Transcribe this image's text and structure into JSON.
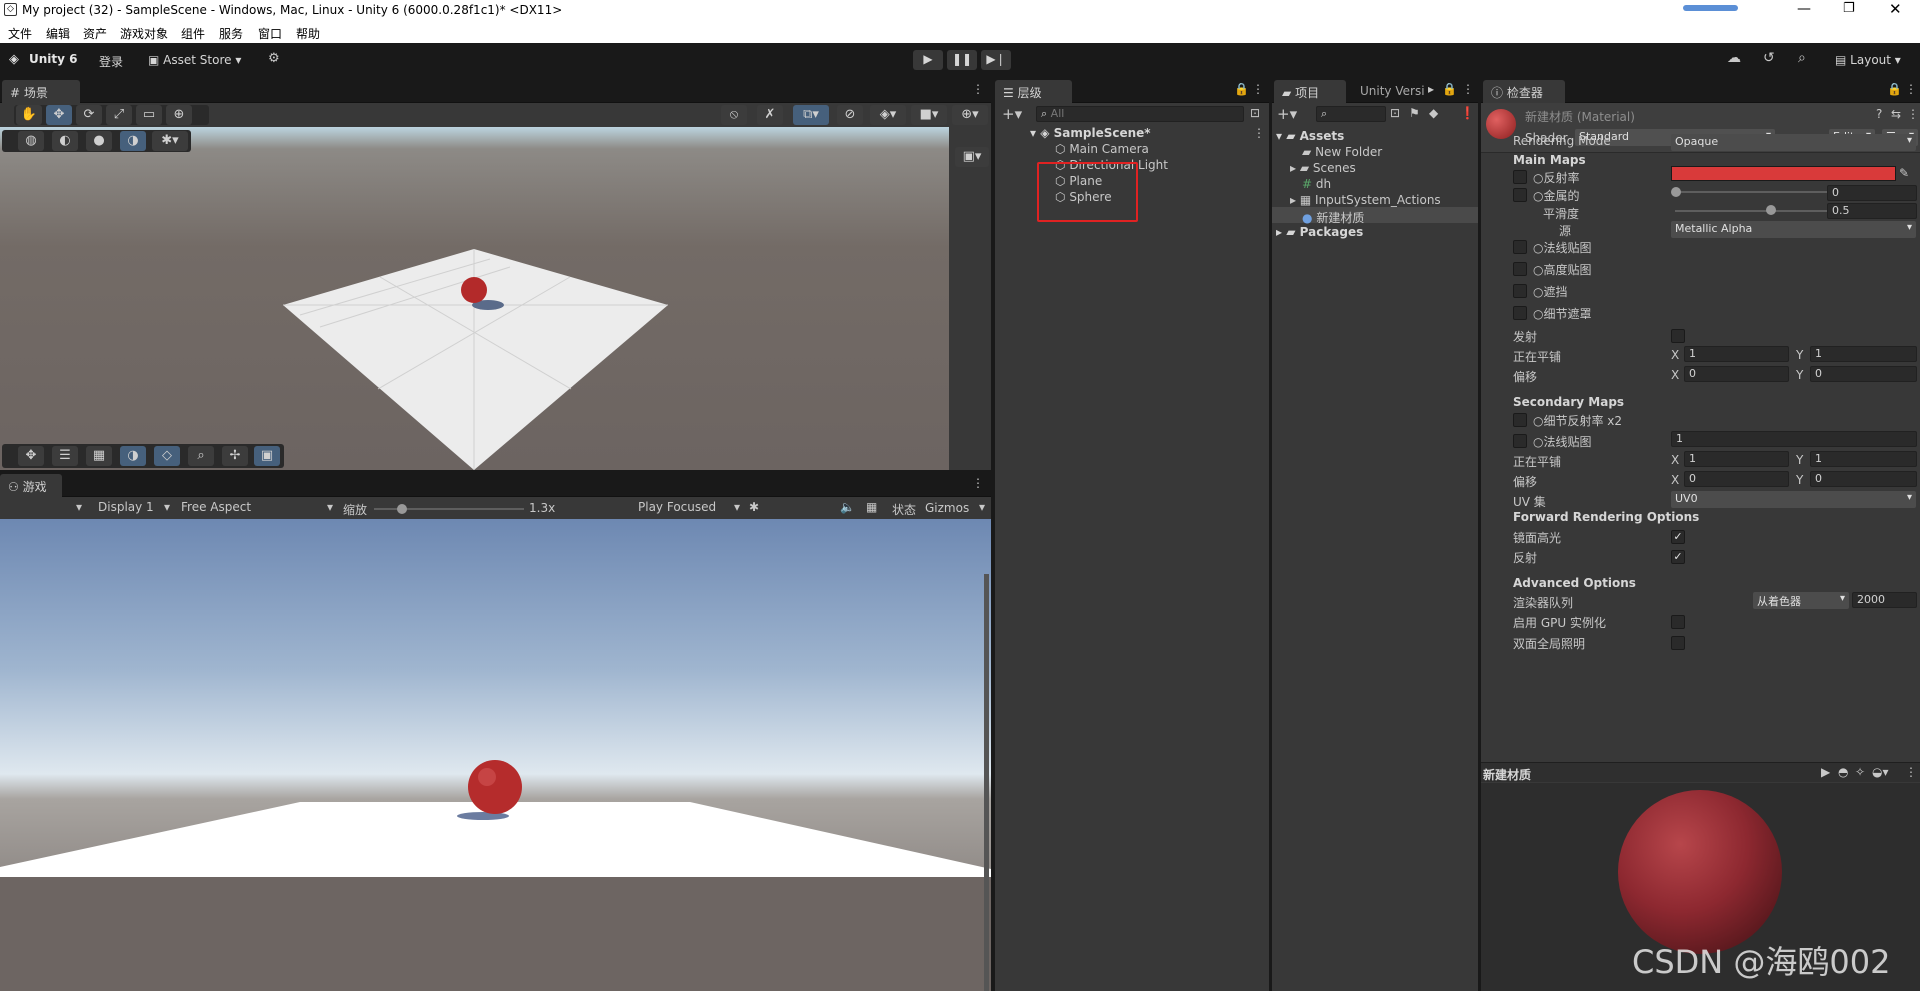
{
  "window": {
    "title": "My project (32) - SampleScene - Windows, Mac, Linux - Unity 6 (6000.0.28f1c1)* <DX11>"
  },
  "menu": [
    "文件",
    "编辑",
    "资产",
    "游戏对象",
    "组件",
    "服务",
    "窗口",
    "帮助"
  ],
  "toolbar": {
    "unity_label": "Unity 6",
    "login_label": "登录",
    "asset_store_label": "Asset Store",
    "layout_label": "Layout"
  },
  "scene": {
    "tab_label": "场景"
  },
  "game": {
    "tab_label": "游戏",
    "display": "Display 1",
    "aspect": "Free Aspect",
    "scale_label": "缩放",
    "scale_value": "1.3x",
    "play_mode": "Play Focused",
    "stats_label": "状态",
    "gizmos_label": "Gizmos"
  },
  "hierarchy": {
    "tab_label": "层级",
    "search_placeholder": "All",
    "scene_name": "SampleScene*",
    "items": [
      "Main Camera",
      "Directional Light",
      "Plane",
      "Sphere"
    ]
  },
  "project": {
    "tab_label": "项目",
    "tab2_label": "Unity Versi",
    "assets_label": "Assets",
    "items": [
      "New Folder",
      "Scenes",
      "dh",
      "InputSystem_Actions",
      "新建材质"
    ],
    "packages_label": "Packages"
  },
  "inspector": {
    "tab_label": "检查器",
    "material_name": "新建材质 (Material)",
    "shader_label": "Shader",
    "shader_value": "Standard",
    "edit_label": "Edit...",
    "rendering_mode_label": "Rendering Mode",
    "rendering_mode_value": "Opaque",
    "main_maps_label": "Main Maps",
    "albedo_label": "反射率",
    "metallic_label": "金属的",
    "metallic_value": "0",
    "smoothness_label": "平滑度",
    "smoothness_value": "0.5",
    "source_label": "源",
    "source_value": "Metallic Alpha",
    "normal_label": "法线贴图",
    "height_label": "高度贴图",
    "occlusion_label": "遮挡",
    "detail_mask_label": "细节遮罩",
    "emission_label": "发射",
    "tiling_label": "正在平铺",
    "offset_label": "偏移",
    "x_label": "X",
    "y_label": "Y",
    "tiling_x": "1",
    "tiling_y": "1",
    "offset_x": "0",
    "offset_y": "0",
    "secondary_maps_label": "Secondary Maps",
    "detail_albedo_label": "细节反射率 x2",
    "sec_normal_label": "法线贴图",
    "sec_normal_value": "1",
    "sec_tiling_x": "1",
    "sec_tiling_y": "1",
    "sec_offset_x": "0",
    "sec_offset_y": "0",
    "uv_set_label": "UV 集",
    "uv_set_value": "UV0",
    "forward_label": "Forward Rendering Options",
    "specular_label": "镜面高光",
    "reflections_label": "反射",
    "advanced_label": "Advanced Options",
    "render_queue_label": "渲染器队列",
    "render_queue_mode": "从着色器",
    "render_queue_value": "2000",
    "gpu_instancing_label": "启用 GPU 实例化",
    "double_sided_gi_label": "双面全局照明",
    "preview_label": "新建材质",
    "albedo_color": "#d93a3a"
  },
  "watermark": "CSDN @海鸥002"
}
